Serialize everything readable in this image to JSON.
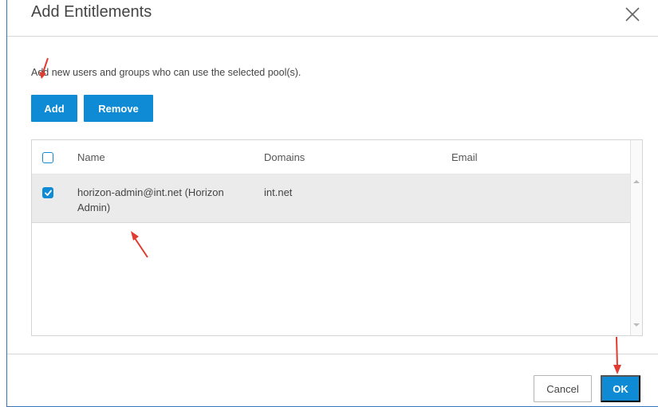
{
  "dialog": {
    "title": "Add Entitlements",
    "description": "Add new users and groups who can use the selected pool(s).",
    "close_icon": "close-icon"
  },
  "toolbar": {
    "add_label": "Add",
    "remove_label": "Remove"
  },
  "grid": {
    "columns": [
      "Name",
      "Domains",
      "Email"
    ],
    "rows": [
      {
        "checked": true,
        "name_line1": "horizon-admin@int.net (Horizon",
        "name_line2": "Admin)",
        "domain": "int.net",
        "email": ""
      }
    ]
  },
  "footer": {
    "cancel_label": "Cancel",
    "ok_label": "OK"
  },
  "colors": {
    "accent": "#0e8bd4",
    "annotation_arrow": "#e03c31",
    "selected_row": "#ebebeb"
  }
}
